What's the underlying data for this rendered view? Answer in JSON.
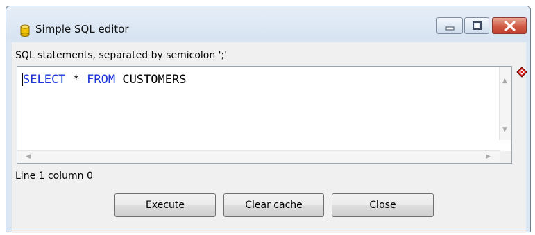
{
  "window": {
    "title": "Simple SQL editor",
    "icon": "database-icon"
  },
  "title_controls": {
    "minimize_icon": "minimize-icon",
    "maximize_icon": "maximize-icon",
    "close_icon": "close-icon"
  },
  "editor": {
    "label": "SQL statements, separated by semicolon ';'",
    "tokens": [
      {
        "text": "SELECT",
        "kind": "keyword"
      },
      {
        "text": " * ",
        "kind": "plain"
      },
      {
        "text": "FROM",
        "kind": "keyword"
      },
      {
        "text": " CUSTOMERS",
        "kind": "plain"
      }
    ],
    "keyword_color": "#1a34d8",
    "marker_icon": "red-diamond-marker-icon"
  },
  "status": {
    "text": "Line 1 column 0"
  },
  "buttons": {
    "execute": {
      "mnemonic": "E",
      "rest": "xecute"
    },
    "clear_cache": {
      "mnemonic": "C",
      "rest": "lear cache"
    },
    "close": {
      "mnemonic": "C",
      "rest": "lose"
    }
  }
}
